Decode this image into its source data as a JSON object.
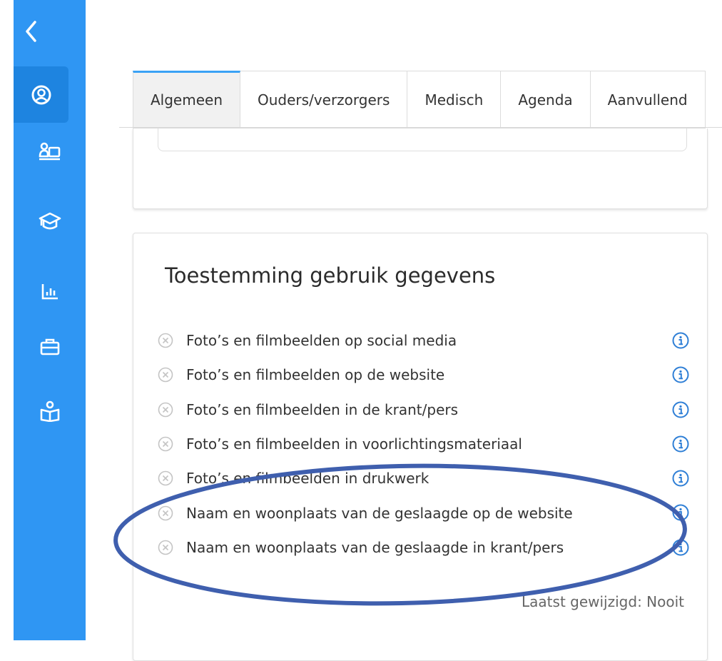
{
  "sidebar": {
    "items": [
      {
        "icon": "back-chevron-icon"
      },
      {
        "icon": "user-circle-icon"
      },
      {
        "icon": "teacher-board-icon"
      },
      {
        "icon": "graduation-cap-icon"
      },
      {
        "icon": "bar-chart-icon"
      },
      {
        "icon": "briefcase-icon"
      },
      {
        "icon": "book-reader-icon"
      }
    ],
    "colors": {
      "bg": "#2f96f3",
      "active": "#1e84e0"
    }
  },
  "tabs": [
    {
      "label": "Algemeen",
      "active": true
    },
    {
      "label": "Ouders/verzorgers",
      "active": false
    },
    {
      "label": "Medisch",
      "active": false
    },
    {
      "label": "Agenda",
      "active": false
    },
    {
      "label": "Aanvullend",
      "active": false
    }
  ],
  "consent": {
    "title": "Toestemming gebruik gegevens",
    "items": [
      {
        "label": "Foto’s en filmbeelden op social media",
        "status": "denied"
      },
      {
        "label": "Foto’s en filmbeelden op de website",
        "status": "denied"
      },
      {
        "label": "Foto’s en filmbeelden in de krant/pers",
        "status": "denied"
      },
      {
        "label": "Foto’s en filmbeelden in voorlichtingsmateriaal",
        "status": "denied"
      },
      {
        "label": "Foto’s en filmbeelden in drukwerk",
        "status": "denied"
      },
      {
        "label": "Naam en woonplaats van de geslaagde op de website",
        "status": "denied"
      },
      {
        "label": "Naam en woonplaats van de geslaagde in krant/pers",
        "status": "denied"
      }
    ],
    "last_modified": "Laatst gewijzigd: Nooit"
  },
  "annotation": {
    "color": "#3f5fae"
  }
}
